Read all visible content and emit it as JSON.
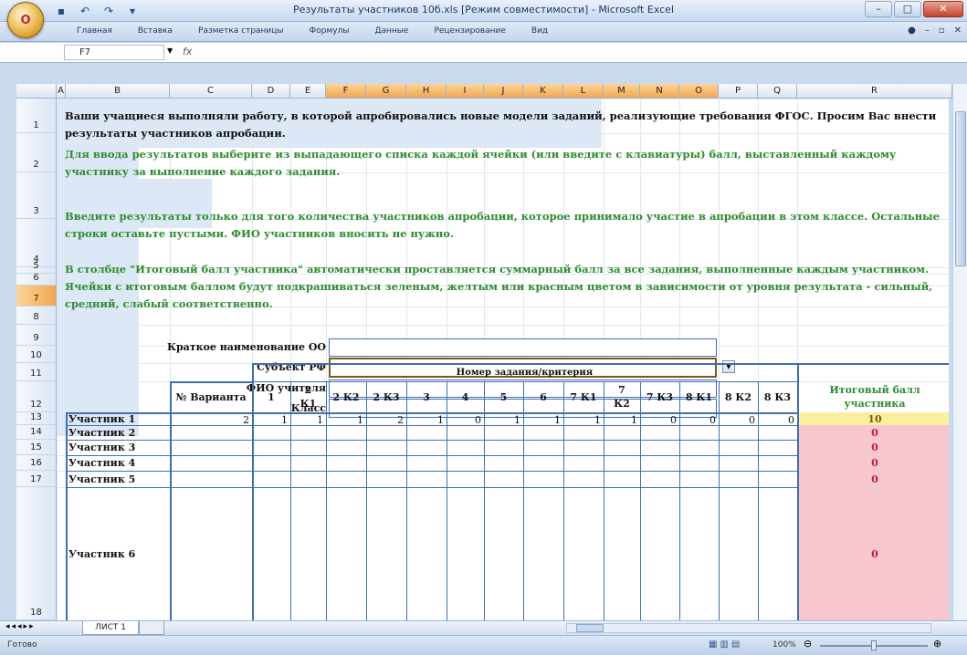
{
  "window": {
    "title": "Результаты участников 10б.xls  [Режим совместимости] - Microsoft Excel",
    "office_button_label": "O"
  },
  "ribbon": {
    "tabs": [
      "Главная",
      "Вставка",
      "Разметка страницы",
      "Формулы",
      "Данные",
      "Рецензирование",
      "Вид"
    ]
  },
  "formula_bar": {
    "name_box": "F7",
    "fx": "fx",
    "content": ""
  },
  "columns": [
    "A",
    "B",
    "C",
    "D",
    "E",
    "F",
    "G",
    "H",
    "I",
    "J",
    "K",
    "L",
    "M",
    "N",
    "O",
    "P",
    "Q",
    "R"
  ],
  "selected_columns": [
    "F",
    "G",
    "H",
    "I",
    "J",
    "K",
    "L",
    "M",
    "N",
    "O"
  ],
  "rows": [
    "1",
    "2",
    "3",
    "4",
    "5",
    "6",
    "7",
    "8",
    "9",
    "10",
    "11",
    "12",
    "13",
    "14",
    "15",
    "16",
    "17",
    "18"
  ],
  "selected_row": "7",
  "notes": {
    "note1": "Ваши учащиеся выполняли работу, в которой апробировались новые модели заданий, реализующие требования ФГОС. Просим Вас внести результаты участников апробации.",
    "note2": "Для ввода результатов выберите из выпадающего списка каждой ячейки (или введите с клавиатуры) балл, выставленный каждому участнику за выполнение каждого задания.",
    "note3": "Введите результаты только для того количества участников апробации, которое принимало участие в апробации в этом классе. Остальные строки оставьте пустыми.   ФИО участников вносить не нужно.",
    "note4": "В столбце \"Итоговый балл участника\" автоматически проставляется суммарный балл за все задания, выполненные каждым участником. Ячейки с итоговым баллом будут подкрашиваться зеленым, желтым или красным цветом в зависимости от уровня результата - сильный, средний, слабый соответственно."
  },
  "form": {
    "org_label": "Краткое наименование ОО",
    "region_label": "Субъект РФ",
    "teacher_label": "ФИО учителя",
    "class_label": "Класс"
  },
  "table": {
    "group_header": "Номер задания/критерия",
    "variant_header": "№ Варианта",
    "total_header": "Итоговый балл участника",
    "task_headers": [
      "1",
      "2 К1",
      "2 К2",
      "2 К3",
      "3",
      "4",
      "5",
      "6",
      "7 К1",
      "7 К2",
      "7 К3",
      "8 К1",
      "8 К2",
      "8 К3"
    ],
    "participants": [
      {
        "name": "Участник 1",
        "variant": "2",
        "scores": [
          "1",
          "1",
          "1",
          "2",
          "1",
          "0",
          "1",
          "1",
          "1",
          "1",
          "0",
          "0",
          "0",
          "0"
        ],
        "total": "10",
        "status": "средний"
      },
      {
        "name": "Участник 2",
        "variant": "",
        "scores": [],
        "total": "0",
        "status": "слабый"
      },
      {
        "name": "Участник 3",
        "variant": "",
        "scores": [],
        "total": "0",
        "status": "слабый"
      },
      {
        "name": "Участник 4",
        "variant": "",
        "scores": [],
        "total": "0",
        "status": "слабый"
      },
      {
        "name": "Участник 5",
        "variant": "",
        "scores": [],
        "total": "0",
        "status": "слабый"
      },
      {
        "name": "Участник 6",
        "variant": "",
        "scores": [],
        "total": "0",
        "status": "слабый"
      }
    ]
  },
  "sheet_tab": "ЛИСТ 1",
  "status": {
    "ready": "Готово",
    "zoom": "100%"
  },
  "colors": {
    "medium": "#fbeea0",
    "weak": "#f7c7cf",
    "header_blue": "#dde8f6",
    "border_blue": "#3f6fb0",
    "green_text": "#2e8b2e"
  }
}
